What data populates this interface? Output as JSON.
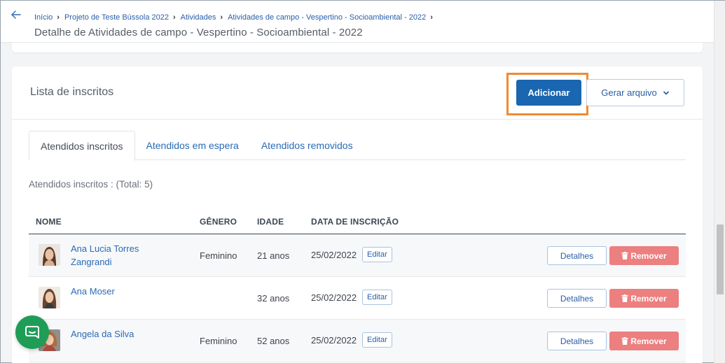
{
  "breadcrumb": {
    "items": [
      "Início",
      "Projeto de Teste Bússola 2022",
      "Atividades",
      "Atividades de campo - Vespertino - Socioambiental - 2022"
    ],
    "separator": "›"
  },
  "page_title": "Detalhe de Atividades de campo - Vespertino - Socioambiental - 2022",
  "card": {
    "title": "Lista de inscritos",
    "add_button": "Adicionar",
    "file_button": "Gerar arquivo"
  },
  "tabs": [
    {
      "label": "Atendidos inscritos",
      "active": true
    },
    {
      "label": "Atendidos em espera",
      "active": false
    },
    {
      "label": "Atendidos removidos",
      "active": false
    }
  ],
  "total_label": "Atendidos inscritos : (Total: 5)",
  "table": {
    "headers": {
      "name": "NOME",
      "gender": "GÊNERO",
      "age": "IDADE",
      "date": "DATA DE INSCRIÇÃO"
    },
    "rows": [
      {
        "name": "Ana Lucia Torres Zangrandi",
        "gender": "Feminino",
        "age": "21 anos",
        "date": "25/02/2022",
        "edit": "Editar",
        "details": "Detalhes",
        "remove": "Remover"
      },
      {
        "name": "Ana Moser",
        "gender": "",
        "age": "32 anos",
        "date": "25/02/2022",
        "edit": "Editar",
        "details": "Detalhes",
        "remove": "Remover"
      },
      {
        "name": "Angela da Silva",
        "gender": "Feminino",
        "age": "52 anos",
        "date": "25/02/2022",
        "edit": "Editar",
        "details": "Detalhes",
        "remove": "Remover"
      }
    ]
  },
  "icons": {
    "back": "arrow-left-icon",
    "file_dropdown": "chevron-down-icon",
    "remove": "trash-icon",
    "chat": "chat-icon"
  },
  "colors": {
    "primary": "#1a66b0",
    "link": "#2a6bb5",
    "danger": "#ec7f7f",
    "highlight": "#f08a32",
    "chat": "#1f9d57"
  }
}
